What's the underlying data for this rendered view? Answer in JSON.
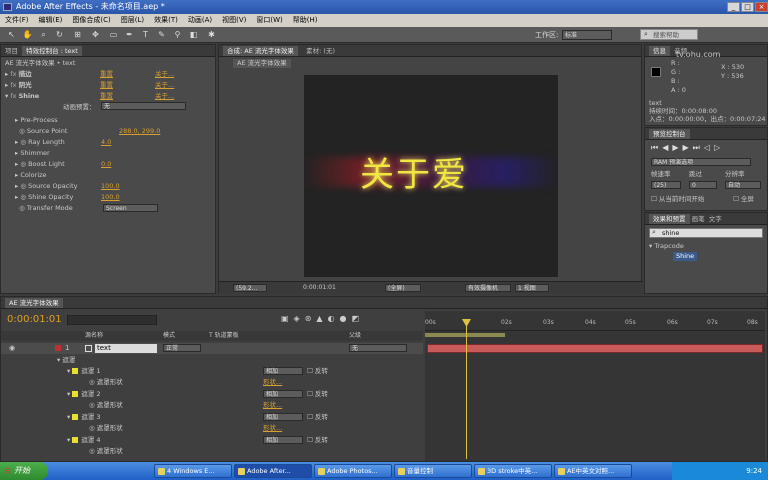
{
  "window": {
    "title": "Adobe After Effects - 未命名项目.aep *"
  },
  "menu": [
    "文件(F)",
    "编辑(E)",
    "图像合成(C)",
    "图层(L)",
    "效果(T)",
    "动画(A)",
    "视图(V)",
    "窗口(W)",
    "帮助(H)"
  ],
  "toolbar": {
    "workspace_label": "工作区:",
    "workspace_value": "标准",
    "search_placeholder": "搜索帮助"
  },
  "watermark": {
    "line1": "tv.ohu.com"
  },
  "effect_controls": {
    "tabs": [
      "项目",
      "特效控制台 : text"
    ],
    "header": "AE 流光字体效果 • text",
    "effects": [
      {
        "name": "描边",
        "reset": "重置",
        "about": "关于..."
      },
      {
        "name": "阴光",
        "reset": "重置",
        "about": "关于..."
      },
      {
        "name": "Shine",
        "reset": "重置",
        "about": "关于..."
      }
    ],
    "preset_label": "动画预置：",
    "preset_value": "无",
    "props": [
      {
        "name": "Pre-Process",
        "value": ""
      },
      {
        "name": "Source Point",
        "value": "288.0, 299.0"
      },
      {
        "name": "Ray Length",
        "value": "4.0"
      },
      {
        "name": "Shimmer",
        "value": ""
      },
      {
        "name": "Boost Light",
        "value": "0.0"
      },
      {
        "name": "Colorize",
        "value": ""
      },
      {
        "name": "Source Opacity",
        "value": "100.0"
      },
      {
        "name": "Shine Opacity",
        "value": "100.0"
      },
      {
        "name": "Transfer Mode",
        "value": "Screen"
      }
    ]
  },
  "composition": {
    "tabs": [
      "合成: AE 流光字体效果",
      "素材: (无)"
    ],
    "subtab": "AE 流光字体效果",
    "text": "关于爱",
    "footer": {
      "zoom": "(59.2...",
      "time": "0:00:01:01",
      "res": "(全屏)",
      "camera": "有效摄像机",
      "views": "1 视图"
    }
  },
  "info": {
    "tabs": [
      "信息",
      "音频"
    ],
    "r": "R :",
    "g": "G :",
    "b": "B :",
    "a": "A : 0",
    "x": "X : 530",
    "y": "Y : 536",
    "layer": "text",
    "duration": "持续时间：0:00:08:00",
    "inout": "入点：0:00:00:00，出点：0:00:07:24"
  },
  "preview": {
    "title": "预览控制台",
    "ram": "RAM 预演选项",
    "fps_label": "帧速率",
    "skip_label": "跳过",
    "res_label": "分辨率",
    "fps": "(25)",
    "skip": "0",
    "res": "自动",
    "from_current": "从当前时间开始",
    "fullscreen": "全屏"
  },
  "effects_presets": {
    "tabs": [
      "效果和预置",
      "画笔",
      "文字"
    ],
    "search": "shine",
    "category": "Trapcode",
    "item": "Shine"
  },
  "timeline": {
    "tab": "AE 流光字体效果",
    "timecode": "0:00:01:01",
    "col_source": "源名称",
    "col_mode": "模式",
    "col_track": "T 轨道蒙板",
    "col_parent": "父级",
    "layer": {
      "num": "1",
      "name": "text",
      "mode": "正常",
      "parent": "无"
    },
    "mask_group": "遮罩",
    "masks": [
      {
        "name": "遮罩 1",
        "mode": "相加",
        "inv": "反转",
        "shape_label": "遮罩形状",
        "shape_val": "形状..."
      },
      {
        "name": "遮罩 2",
        "mode": "相加",
        "inv": "反转",
        "shape_label": "遮罩形状",
        "shape_val": "形状..."
      },
      {
        "name": "遮罩 3",
        "mode": "相加",
        "inv": "反转",
        "shape_label": "遮罩形状",
        "shape_val": "形状..."
      },
      {
        "name": "遮罩 4",
        "mode": "相加",
        "inv": "反转",
        "shape_label": "遮罩形状",
        "shape_val": ""
      }
    ],
    "ruler": [
      "00s",
      "02s",
      "03s",
      "04s",
      "05s",
      "06s",
      "07s",
      "08s"
    ]
  },
  "taskbar": {
    "start": "开始",
    "items": [
      "4 Windows E...",
      "Adobe After...",
      "Adobe Photos...",
      "音量控制",
      "3D stroke中英...",
      "AE中英文对照..."
    ],
    "clock": "9:24"
  }
}
